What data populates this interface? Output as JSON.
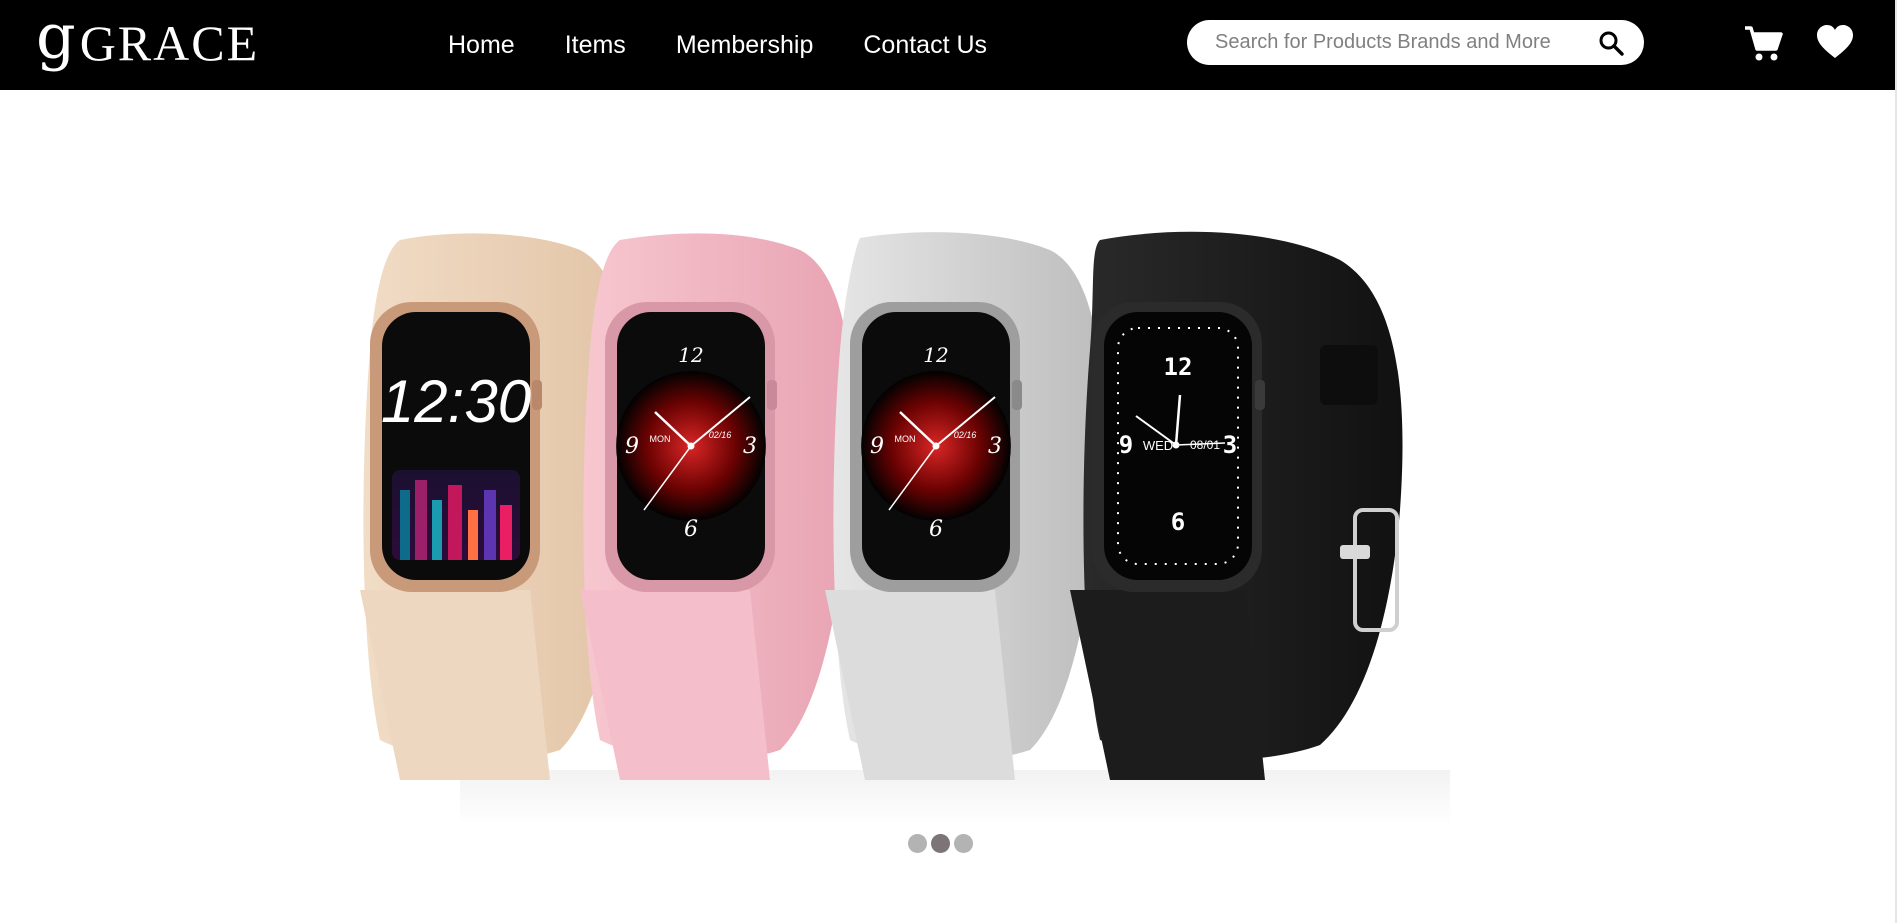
{
  "brand": {
    "mark": "g",
    "name": "GRACE"
  },
  "nav": {
    "links": [
      {
        "label": "Home"
      },
      {
        "label": "Items"
      },
      {
        "label": "Membership"
      },
      {
        "label": "Contact Us"
      }
    ]
  },
  "search": {
    "placeholder": "Search for Products Brands and More",
    "value": "",
    "icon": "search-icon"
  },
  "header_icons": {
    "cart": "cart-icon",
    "wishlist": "heart-icon"
  },
  "colors": {
    "navbar": "#000000",
    "text_on_nav": "#ffffff",
    "dot": "#b3b3b3",
    "dot_active": "#7d7478"
  },
  "carousel": {
    "slide_count": 3,
    "active_index": 1,
    "slide": {
      "subject": "four smartwatches",
      "watches": [
        {
          "band": "beige",
          "face": "digital",
          "time": "12:30"
        },
        {
          "band": "pink",
          "face": "analog",
          "date": "02/16",
          "day": "MON",
          "numerals": [
            "12",
            "3",
            "6",
            "9"
          ]
        },
        {
          "band": "silver",
          "face": "analog",
          "date": "02/16",
          "day": "MON",
          "numerals": [
            "12",
            "3",
            "6",
            "9"
          ]
        },
        {
          "band": "black",
          "face": "analog",
          "date": "08/01",
          "day": "WED",
          "numerals": [
            "12",
            "3",
            "6",
            "9"
          ]
        }
      ]
    }
  }
}
